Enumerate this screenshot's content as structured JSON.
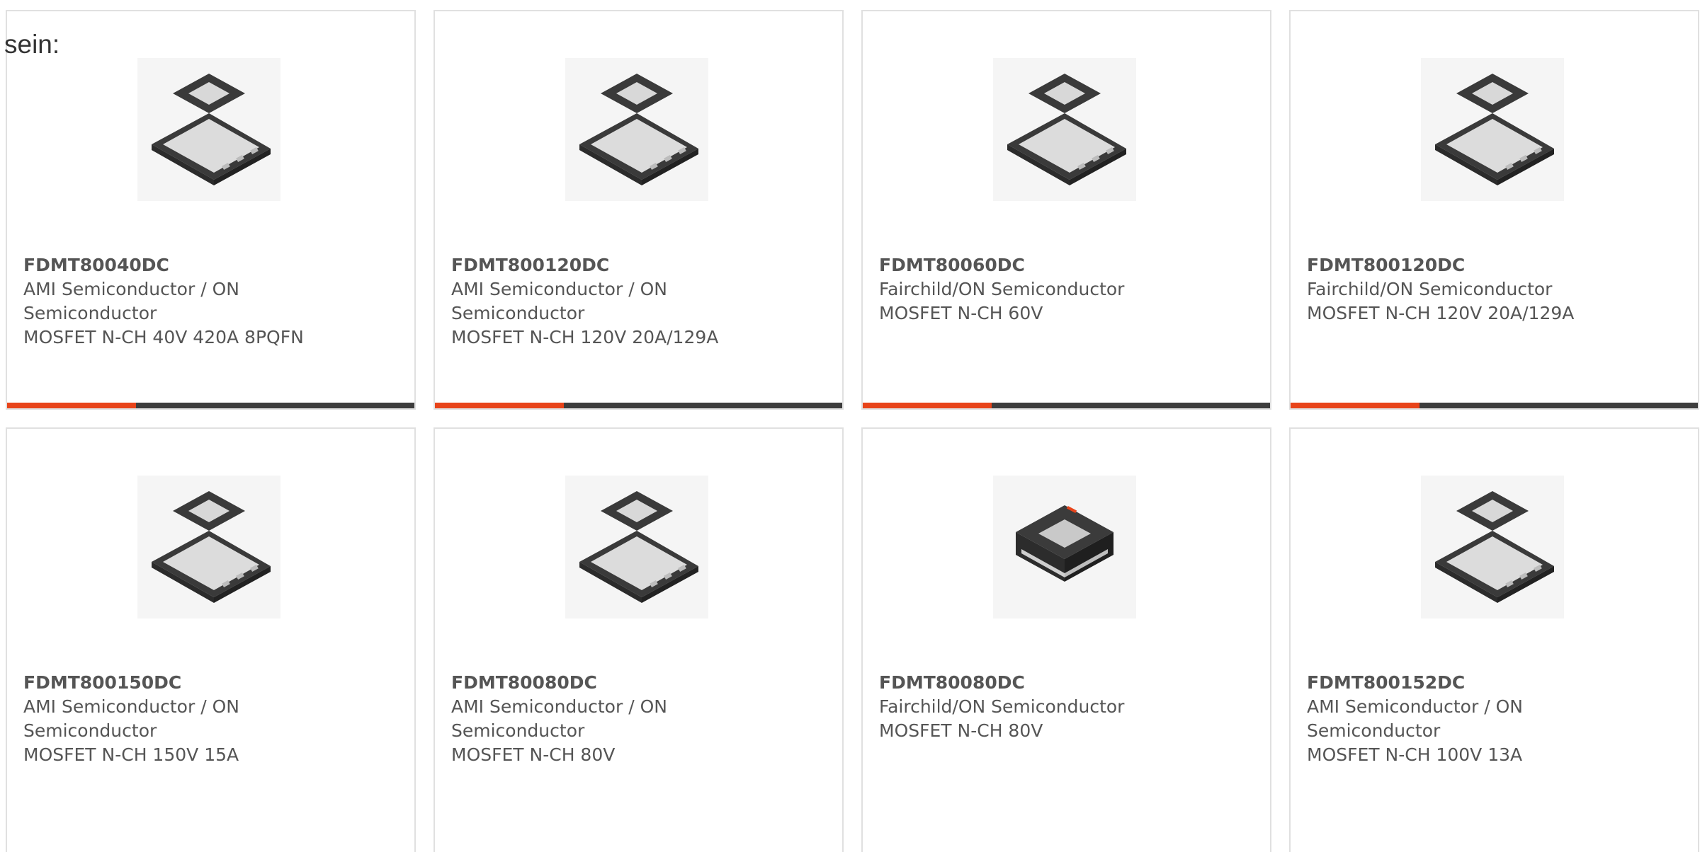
{
  "lead_text": "sein:",
  "colors": {
    "accent": "#e8441a",
    "bar": "#3d3d3d",
    "text": "#555555",
    "border": "#e0e0e0"
  },
  "products": [
    {
      "part_number": "FDMT80040DC",
      "manufacturer": "AMI Semiconductor / ON Semiconductor",
      "description": "MOSFET N-CH 40V 420A 8PQFN",
      "image_icon": "pqfn-package-icon"
    },
    {
      "part_number": "FDMT800120DC",
      "manufacturer": "AMI Semiconductor / ON Semiconductor",
      "description": "MOSFET N-CH 120V 20A/129A",
      "image_icon": "pqfn-package-icon"
    },
    {
      "part_number": "FDMT80060DC",
      "manufacturer": "Fairchild/ON Semiconductor",
      "description": "MOSFET N-CH 60V",
      "image_icon": "pqfn-package-icon"
    },
    {
      "part_number": "FDMT800120DC",
      "manufacturer": "Fairchild/ON Semiconductor",
      "description": "MOSFET N-CH 120V 20A/129A",
      "image_icon": "pqfn-package-icon"
    },
    {
      "part_number": "FDMT800150DC",
      "manufacturer": "AMI Semiconductor / ON Semiconductor",
      "description": "MOSFET N-CH 150V 15A",
      "image_icon": "pqfn-package-icon"
    },
    {
      "part_number": "FDMT80080DC",
      "manufacturer": "AMI Semiconductor / ON Semiconductor",
      "description": "MOSFET N-CH 80V",
      "image_icon": "pqfn-package-icon"
    },
    {
      "part_number": "FDMT80080DC",
      "manufacturer": "Fairchild/ON Semiconductor",
      "description": "MOSFET N-CH 80V",
      "image_icon": "dual-cool-package-icon"
    },
    {
      "part_number": "FDMT800152DC",
      "manufacturer": "AMI Semiconductor / ON Semiconductor",
      "description": "MOSFET N-CH 100V 13A",
      "image_icon": "pqfn-package-icon"
    }
  ]
}
